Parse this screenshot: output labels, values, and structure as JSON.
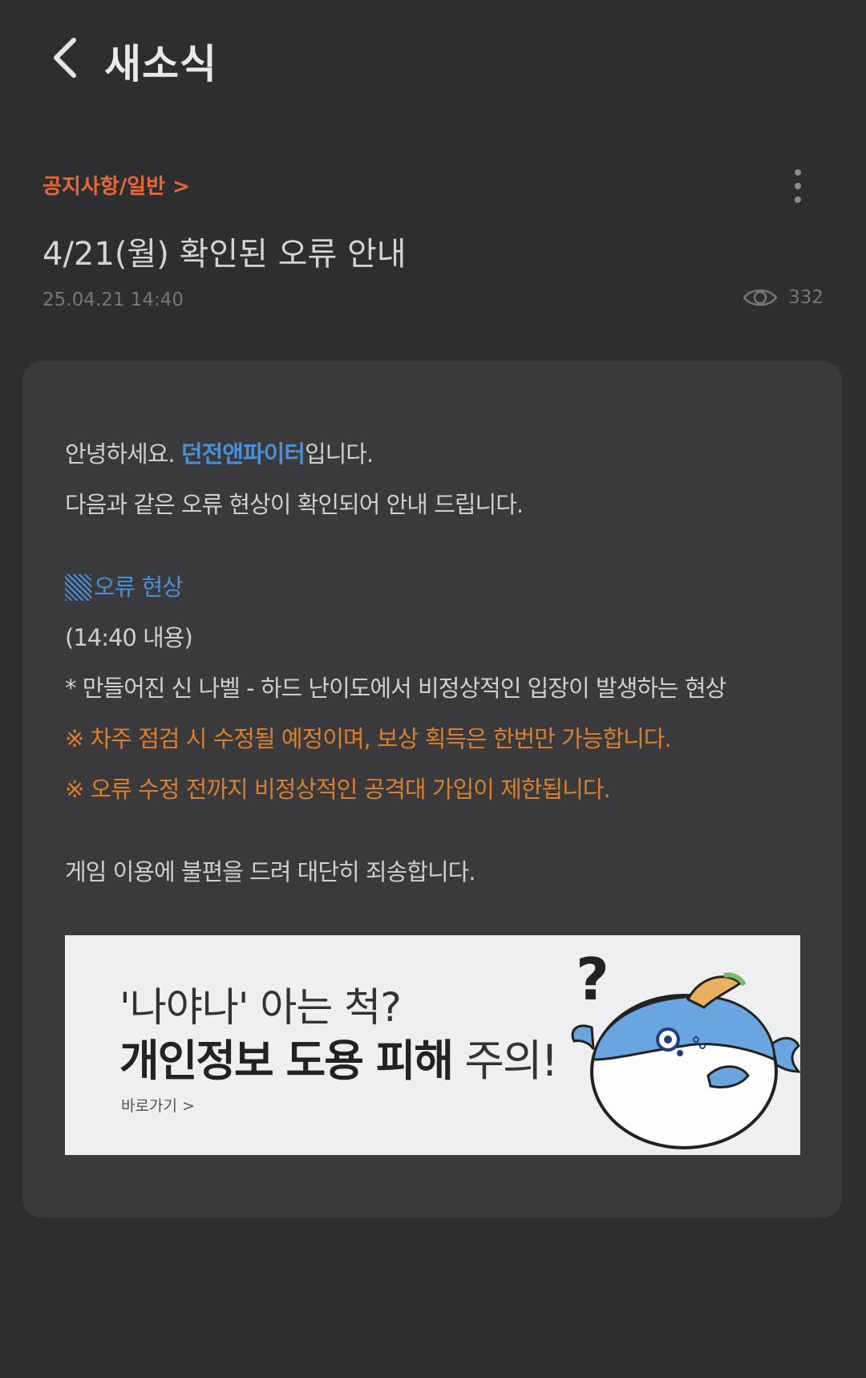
{
  "header": {
    "title": "새소식"
  },
  "post": {
    "category": "공지사항/일반 >",
    "title": "4/21(월) 확인된 오류 안내",
    "date": "25.04.21 14:40",
    "views": "332"
  },
  "body": {
    "greeting_prefix": "안녕하세요. ",
    "greeting_brand": "던전앤파이터",
    "greeting_suffix": "입니다.",
    "intro": "다음과 같은 오류 현상이 확인되어 안내 드립니다.",
    "section_title": "오류 현상",
    "time_note": "(14:40 내용)",
    "issue": "* 만들어진 신 나벨 - 하드 난이도에서 비정상적인 입장이 발생하는 현상",
    "warning1": "※ 차주 점검 시 수정될 예정이며, 보상 획득은 한번만 가능합니다.",
    "warning2": "※ 오류 수정 전까지 비정상적인 공격대 가입이 제한됩니다.",
    "apology": "게임 이용에 불편을 드려 대단히 죄송합니다."
  },
  "banner": {
    "line1": "'나야나' 아는 척?",
    "line2_bold": "개인정보 도용 피해",
    "line2_light": " 주의!",
    "link": "바로가기 >"
  },
  "colors": {
    "background": "#2e2e31",
    "card": "#3a3a3d",
    "category": "#e3683a",
    "brand_blue": "#4a90d9",
    "warning": "#d88030"
  },
  "icons": {
    "back": "chevron-left-icon",
    "more": "more-vertical-icon",
    "views": "eye-icon"
  }
}
